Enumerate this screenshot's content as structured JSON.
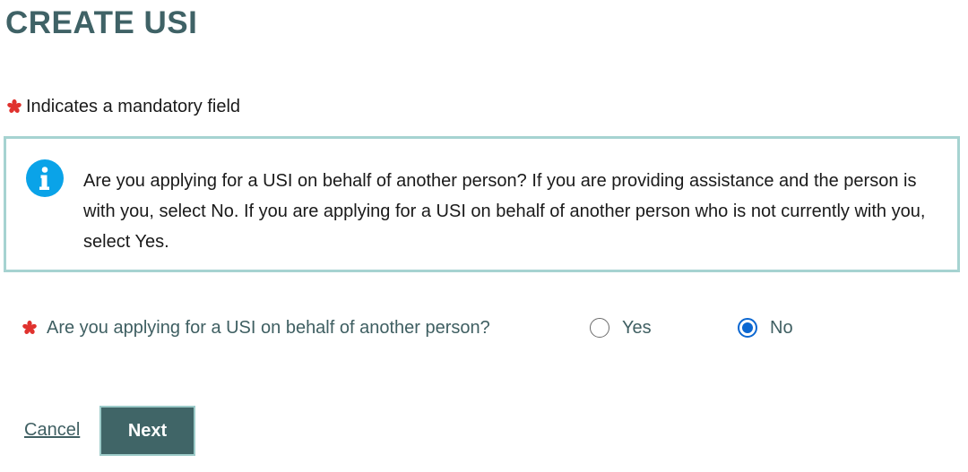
{
  "page": {
    "title": "CREATE USI"
  },
  "mandatory_note": {
    "text": "Indicates a mandatory field",
    "icon": "required-asterisk-icon",
    "color": "#e0322e"
  },
  "info_box": {
    "icon": "info-icon",
    "icon_color": "#0aa3e8",
    "border_color": "#a6d3d1",
    "text": "Are you applying for a USI on behalf of another person? If you are providing assistance and the person is with you, select No. If you are applying for a USI on behalf of another person who is not currently with you, select Yes."
  },
  "question": {
    "label": "Are you applying for a USI on behalf of another person?",
    "required": true,
    "options": [
      {
        "label": "Yes",
        "selected": false
      },
      {
        "label": "No",
        "selected": true
      }
    ],
    "selected_value": "No"
  },
  "actions": {
    "cancel_label": "Cancel",
    "next_label": "Next",
    "next_color": "#406567"
  },
  "colors": {
    "title": "#3f6266",
    "label_text": "#3f5f62",
    "radio_selected": "#0b67d1"
  }
}
